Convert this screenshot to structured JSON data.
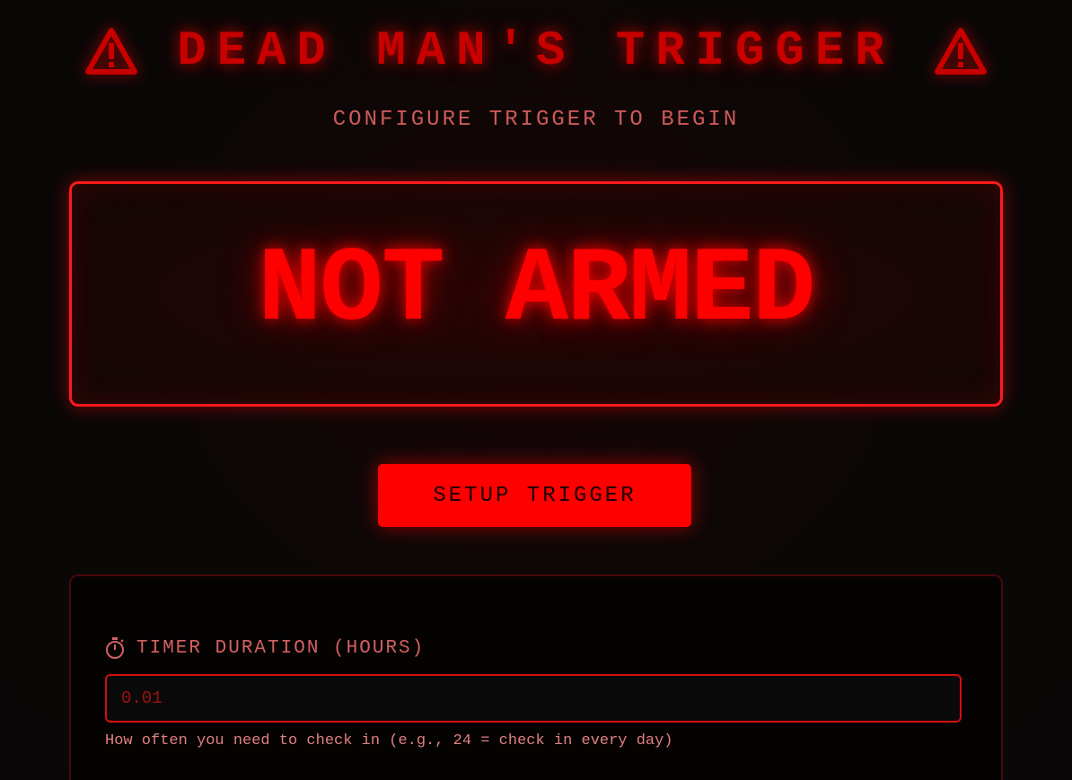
{
  "header": {
    "title": "DEAD MAN'S TRIGGER",
    "left_icon": "warning-icon",
    "right_icon": "warning-icon",
    "subtitle": "CONFIGURE TRIGGER TO BEGIN"
  },
  "status": {
    "text": "NOT ARMED"
  },
  "actions": {
    "setup_label": "SETUP TRIGGER"
  },
  "config": {
    "timer": {
      "icon": "stopwatch-icon",
      "label": "TIMER DURATION (HOURS)",
      "value": "0.01",
      "help": "How often you need to check in (e.g., 24 = check in every day)"
    }
  },
  "colors": {
    "accent": "#ff0000",
    "title": "#c80000",
    "subtitle": "#cc5a5a",
    "background": "#0a0606"
  }
}
